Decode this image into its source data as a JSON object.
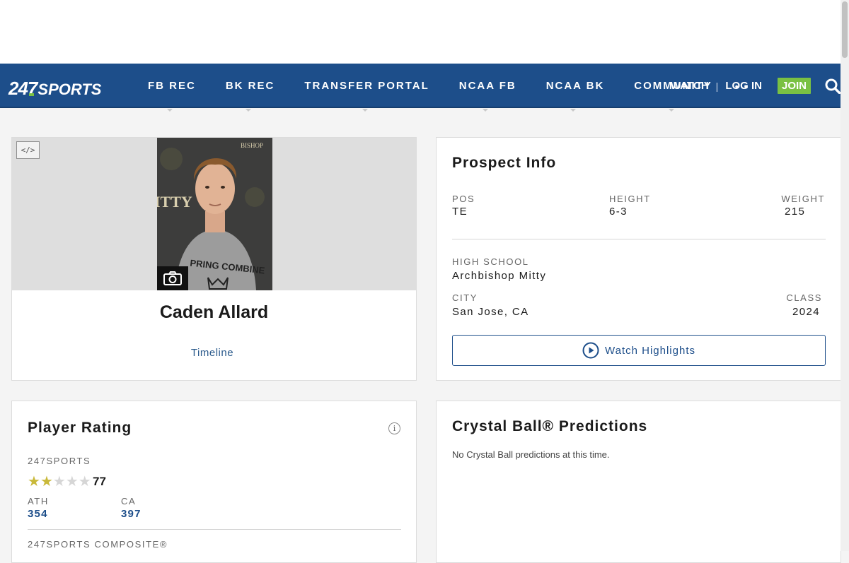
{
  "nav": {
    "logo_num": "24",
    "logo_seven": "7",
    "logo_word": "SPORTS",
    "items": [
      {
        "label": "FB REC"
      },
      {
        "label": "BK REC"
      },
      {
        "label": "TRANSFER PORTAL"
      },
      {
        "label": "NCAA FB"
      },
      {
        "label": "NCAA BK"
      },
      {
        "label": "COMMUNITY"
      }
    ],
    "more": "• •",
    "watch": "WATCH",
    "separator": "|",
    "login": "LOG IN",
    "join": "JOIN"
  },
  "profile": {
    "embed_label": "</>",
    "name": "Caden Allard",
    "timeline": "Timeline",
    "photo_text_top": "BISHOP",
    "photo_text_left": "ITTY",
    "photo_shirt": "PRING COMBINE"
  },
  "prospect": {
    "title": "Prospect Info",
    "pos_label": "POS",
    "pos": "TE",
    "height_label": "HEIGHT",
    "height": "6-3",
    "weight_label": "WEIGHT",
    "weight": "215",
    "school_label": "HIGH SCHOOL",
    "school": "Archbishop Mitty",
    "city_label": "CITY",
    "city": "San Jose, CA",
    "class_label": "CLASS",
    "class": "2024",
    "highlights": "Watch Highlights"
  },
  "rating": {
    "title": "Player Rating",
    "info": "i",
    "source": "247SPORTS",
    "stars": 2,
    "stars_max": 5,
    "score": "77",
    "pos_rank_label": "ATH",
    "pos_rank": "354",
    "state_rank_label": "CA",
    "state_rank": "397",
    "composite_label": "247SPORTS COMPOSITE®"
  },
  "crystal": {
    "title": "Crystal Ball® Predictions",
    "note": "No Crystal Ball predictions at this time."
  },
  "colors": {
    "nav_bg": "#1d4e8a",
    "join_green": "#7ac143",
    "link_blue": "#2b5a8c",
    "star_gold": "#c9b93a"
  }
}
